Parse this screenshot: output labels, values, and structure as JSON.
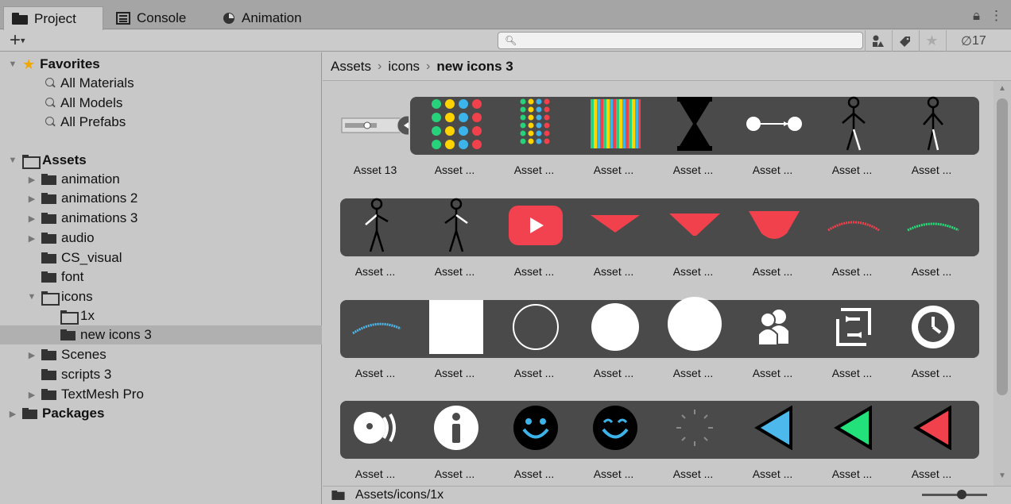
{
  "tabs": [
    {
      "label": "Project",
      "icon": "folder-icon"
    },
    {
      "label": "Console",
      "icon": "console-icon"
    },
    {
      "label": "Animation",
      "icon": "animation-clock-icon"
    }
  ],
  "toolbar": {
    "add_label": "+",
    "search_placeholder": "",
    "hidden_count": "17"
  },
  "tree": {
    "favorites_label": "Favorites",
    "favorites": [
      "All Materials",
      "All Models",
      "All Prefabs"
    ],
    "assets_label": "Assets",
    "folders": [
      {
        "label": "animation"
      },
      {
        "label": "animations 2"
      },
      {
        "label": "animations 3"
      },
      {
        "label": "audio"
      },
      {
        "label": "CS_visual"
      },
      {
        "label": "font"
      },
      {
        "label": "icons"
      },
      {
        "label": "1x"
      },
      {
        "label": "new icons 3"
      },
      {
        "label": "Scenes"
      },
      {
        "label": "scripts 3"
      },
      {
        "label": "TextMesh Pro"
      }
    ],
    "packages_label": "Packages"
  },
  "breadcrumb": [
    "Assets",
    "icons",
    "new icons 3"
  ],
  "grid": {
    "row1": [
      "Asset 13",
      "Asset ...",
      "Asset ...",
      "Asset ...",
      "Asset ...",
      "Asset ...",
      "Asset ...",
      "Asset ..."
    ],
    "row2": [
      "Asset ...",
      "Asset ...",
      "Asset ...",
      "Asset ...",
      "Asset ...",
      "Asset ...",
      "Asset ...",
      "Asset ..."
    ],
    "row3": [
      "Asset ...",
      "Asset ...",
      "Asset ...",
      "Asset ...",
      "Asset ...",
      "Asset ...",
      "Asset ...",
      "Asset ..."
    ],
    "row4": [
      "Asset ...",
      "Asset ...",
      "Asset ...",
      "Asset ...",
      "Asset ...",
      "Asset ...",
      "Asset ...",
      "Asset ..."
    ]
  },
  "status": {
    "path": "Assets/icons/1x"
  },
  "colors": {
    "strip_bg": "#4a4a4a",
    "selection": "#b0b0b0",
    "youtube_red": "#f2414f",
    "smile_blue": "#3cb4ea",
    "arrow_green": "#22e07a",
    "arrow_red": "#f0414c",
    "arrow_blue": "#4cb8ec"
  }
}
